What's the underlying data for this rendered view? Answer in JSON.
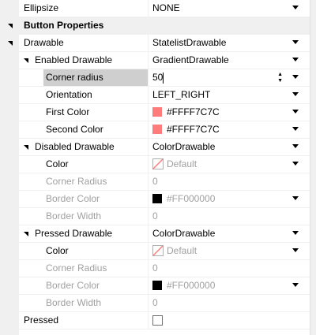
{
  "rows": [
    {
      "name": "Ellipsize",
      "value": "NONE"
    },
    {
      "name": "Button Properties"
    },
    {
      "name": "Drawable",
      "value": "StatelistDrawable"
    },
    {
      "name": "Enabled Drawable",
      "value": "GradientDrawable"
    },
    {
      "name": "Corner radius",
      "value": "50"
    },
    {
      "name": "Orientation",
      "value": "LEFT_RIGHT"
    },
    {
      "name": "First Color",
      "value": "#FFFF7C7C"
    },
    {
      "name": "Second Color",
      "value": "#FFFF7C7C"
    },
    {
      "name": "Disabled Drawable",
      "value": "ColorDrawable"
    },
    {
      "name": "Color",
      "value": "Default"
    },
    {
      "name": "Corner Radius",
      "value": "0"
    },
    {
      "name": "Border Color",
      "value": "#FF000000"
    },
    {
      "name": "Border Width",
      "value": "0"
    },
    {
      "name": "Pressed Drawable",
      "value": "ColorDrawable"
    },
    {
      "name": "Color",
      "value": "Default"
    },
    {
      "name": "Corner Radius",
      "value": "0"
    },
    {
      "name": "Border Color",
      "value": "#FF000000"
    },
    {
      "name": "Border Width",
      "value": "0"
    },
    {
      "name": "Pressed",
      "value": false
    }
  ],
  "colors": {
    "first_color": "#FF7C7C",
    "second_color": "#FF7C7C",
    "border_color_disabled": "#000000",
    "border_color_pressed": "#000000",
    "selection": "#cfcfcf",
    "gutter": "#f0f0f0"
  }
}
